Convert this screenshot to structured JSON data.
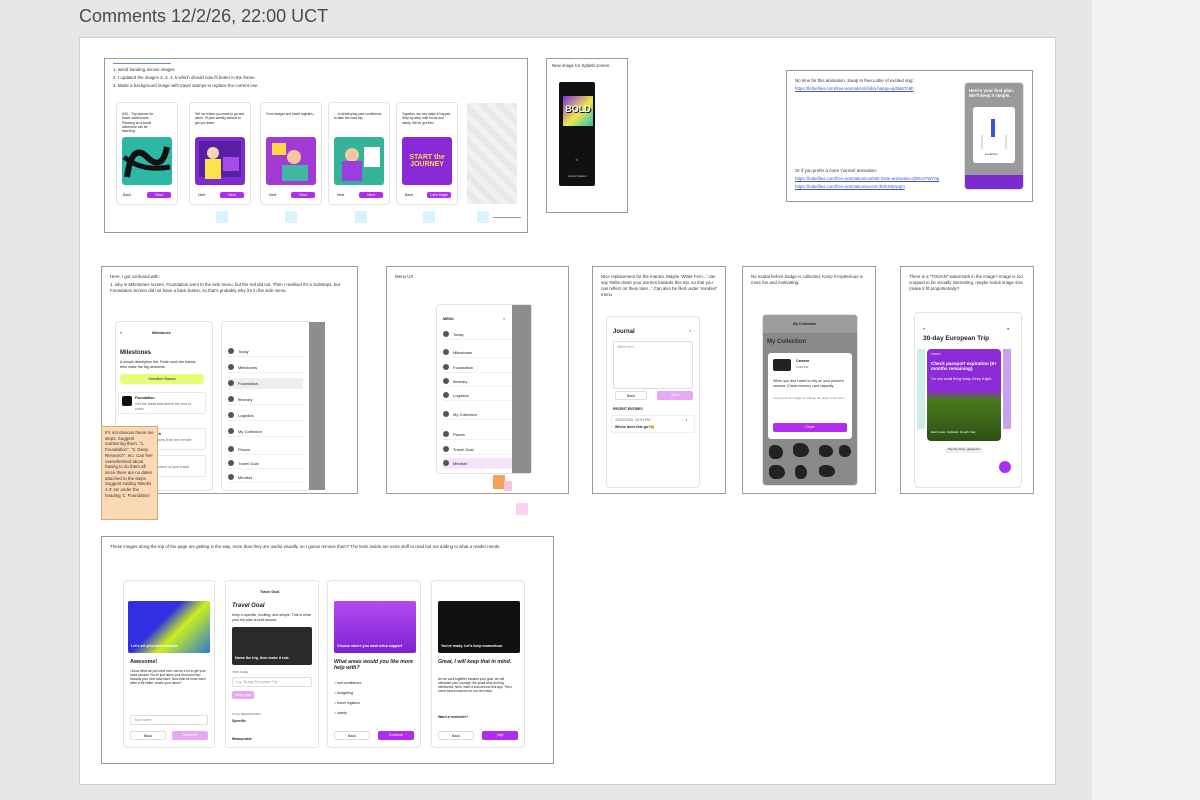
{
  "page_title": "Comments 12/2/26, 22:00 UCT",
  "frame1": {
    "notes": [
      "1. weird banding across images",
      "2. I updated the images 2, 3, 4, 5 which should now fit better in the frame.",
      "3. Made a background image with travel stamps to replace the current one."
    ],
    "screens": [
      {
        "text": "(Hi!) - Trip planner for brave adventurers. Planning an a travel adventure can be daunting.",
        "next": "Next"
      },
      {
        "text": "Tell me where you want to go and when. I'll plan weekly actions to get you there.",
        "next": "Next"
      },
      {
        "text": "From budget and travel logistics...",
        "next": "Next"
      },
      {
        "text": "... to developing your confidence to take the road trip.",
        "next": "Next"
      },
      {
        "text": "Together, we can make it happen. Step-by-step, with focus and clarity. We've got this!",
        "next": "Let's begin"
      }
    ],
    "back": "Back",
    "journey_text": "START the JOURNEY"
  },
  "frame2": {
    "label": "New image for Splash screen",
    "splash_word": "BOLD",
    "footer": "Getting Started"
  },
  "frame3": {
    "note1": "No time for this animation. Swap to free Lottie of excited dog:",
    "link1": "https://lottiefiles.com/free-animation/shiba-happy-ejd3a67n6b",
    "note2": "Or if you prefer a more 'normal' animation:",
    "link2": "https://lottiefiles.com/free-animation/confetti-lottie-animation-qhRc07WY0p",
    "link3": "https://lottiefiles.com/free-animation/secret-3fdXX5ewqm",
    "phone_title": "Here's your first plan. We'll keep it simple.",
    "phone_sub": "Locked in"
  },
  "frame4": {
    "intro": "Here, I got confused with:",
    "point": "1. why in Milestones screen, Foundation went to the side menu, but the red did not. Then I realised it's a Substeps, but Foundation Screen did not have a back button, so that's probably why it's in the side menu.",
    "header": "Milestones",
    "heading": "Milestones",
    "desc": "A simple description tbd. Finish work the basics, then make the big decisions.",
    "pill": "Headline Basics",
    "items": [
      {
        "title": "Foundation",
        "desc": "Get the tasks that define the rest to come."
      },
      {
        "title": "Deep Research",
        "desc": "Collect the lessons from the remote experience."
      },
      {
        "title": "Big Bookings",
        "desc": "Lock in the structure of your travel."
      }
    ],
    "menu": [
      "Today",
      "Milestones",
      "Foundation",
      "Itinerary",
      "Logistics",
      "My Collection",
      "Places",
      "Travel Goal",
      "Mindset"
    ]
  },
  "sticky": "It's not obvious these are steps. Suggest numbering them, \"1. Foundation\", \"2. Deep Research\", etc. Can feel overwhelmed about having to do them all since there are no dates attached to the steps. Suggest Adding 'Weeks 1-3' etc under the heading '1. Foundation'",
  "frame5": {
    "label": "Menu UX",
    "menu_header": "MENU",
    "menu": [
      "Today",
      "Milestones",
      "Foundation",
      "Itinerary",
      "Logistics",
      "My Collection",
      "Places",
      "Travel Goal",
      "Mindset"
    ]
  },
  "frame6": {
    "note": "Nice replacement for the mantra. Maybe 'White Fem...' can say 'Write down your worries towards this trip, so that you can reflect on them later...' Can also be filed under 'mindset' menu",
    "title": "Journal",
    "placeholder": "Write here...",
    "back": "Back",
    "save": "Save",
    "recent": "RECENT ENTRIES",
    "entry_date": "12/02/2026, 09:04 PM",
    "entry": "Where does this go?😄"
  },
  "frame7": {
    "note": "No modal before badge is collected. Keep it mysterious is more fun and motivating.",
    "header": "My Collection",
    "heading": "My Collection",
    "modal_title": "Camera",
    "modal_tag": "SURVIVE",
    "modal_text": "When you don't want to rely on your phone's camera. Check memory card capacity.",
    "modal_text2": "Long press the badge to change the label on this item",
    "modal_button": "Close"
  },
  "frame8": {
    "note": "There is a \"TOOAN\" watermark in the image? Image is too cropped to be visually interesting, maybe redoit image size (make it fit proportionally?",
    "heading": "30-day European Trip",
    "card_tag": "TODAY",
    "card_title": "Check passport expiration (6+ months remaining).",
    "card_text": "On one small thing today. Keep it light.",
    "card_footer": "Each pose: Updated: Rough Calc",
    "chip": "Tap the done, great job!"
  },
  "frame9": {
    "note": "These images along the top of the page are getting in the way, more than they are useful visually, so I guess remove them? The texts inside are extra stuff to read but not adding to what a reader needs.",
    "screens": [
      {
        "banner": "Let's set your bold baseline",
        "heading": "Awesome!",
        "body": "I know what we just went over can be a lot to get your head around! You've just taken your first bold step towards your next adventure. Now that we know each other a bit better, what's your name?",
        "input": "Your name",
        "back": "Back",
        "primary": "Continue"
      },
      {
        "header": "Travel Goal",
        "heading": "Travel Goal",
        "body": "Keep it specific, exciting, and simple. This is what your trip plan is built around.",
        "banner": "Name the trip, then make it real.",
        "label": "TRIP NAME",
        "input": "e.g. 30-day European Trip",
        "chip": "Save goal",
        "sub": "GOAL BREAKDOWN",
        "specific": "Specific",
        "measurable": "Measurable"
      },
      {
        "banner": "Choose where you want extra support",
        "heading": "What areas would you like more help with?",
        "options": [
          "self-confidence",
          "budgeting",
          "travel logistics",
          "safety"
        ],
        "back": "Back",
        "primary": "Continue"
      },
      {
        "banner": "You're ready. Let's keep momentum.",
        "heading": "Great, I will keep that in mind.",
        "body": "As we work together towards your goal, we will celebrate your courage, the small wins and big milestones. Next, have a look around this app. Then, come back tomorrow for our next step.",
        "reminder": "Want a reminder?",
        "back": "Back",
        "primary": "Yay!"
      }
    ]
  },
  "colors": {
    "accent": "#b12cf0",
    "sticky": "#fcd9b6",
    "board": "#ffffff"
  }
}
